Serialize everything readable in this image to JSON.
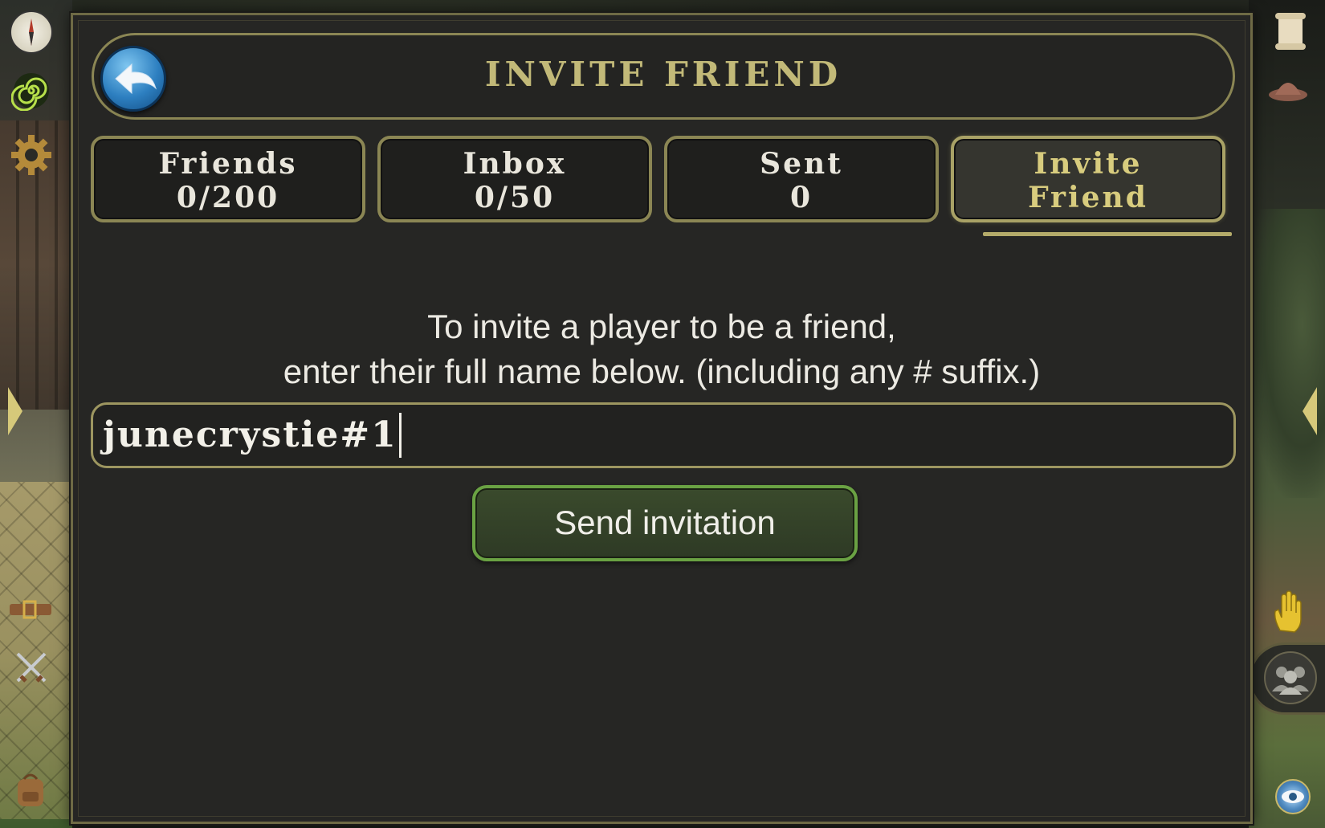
{
  "header": {
    "title": "INVITE FRIEND",
    "back_icon": "back-arrow-icon"
  },
  "tabs": [
    {
      "line1": "Friends",
      "line2": "0/200",
      "active": false
    },
    {
      "line1": "Inbox",
      "line2": "0/50",
      "active": false
    },
    {
      "line1": "Sent",
      "line2": "0",
      "active": false
    },
    {
      "line1": "Invite",
      "line2": "Friend",
      "active": true
    }
  ],
  "instruction": {
    "line1": "To invite a player to be a friend,",
    "line2": "enter their full name below. (including any # suffix.)"
  },
  "name_input": {
    "value": "junecrystie#1"
  },
  "send_button": {
    "label": "Send invitation"
  },
  "side_icons": {
    "left": [
      "compass-icon",
      "spiral-icon",
      "gear-icon",
      "expand-left-arrow-icon",
      "belt-icon",
      "crossed-swords-icon",
      "backpack-icon"
    ],
    "right": [
      "scroll-icon",
      "hat-icon",
      "expand-right-arrow-icon",
      "hand-icon",
      "group-icon",
      "eye-icon"
    ]
  },
  "colors": {
    "accent_gold": "#c2b978",
    "border_gold": "#8b8654",
    "send_green": "#6aa243",
    "panel_bg": "#262624"
  }
}
